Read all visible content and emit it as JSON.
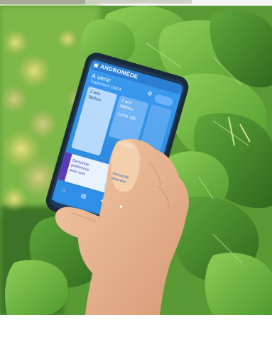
{
  "app": {
    "brand": "ANDROMÈDE",
    "section_title": "A venir",
    "subtitle": "Traitement 16/04",
    "card_1_line_1": "2 ans",
    "card_1_line_2": "Biobox",
    "card_2_line_1": "2 ans",
    "card_2_line_2": "Mildiou",
    "card_2_line_3": "12/04 18h",
    "tab_left_line_1": "Demande",
    "tab_left_line_2": "préférence",
    "tab_left_line_3": "pour une",
    "tab_right_line_1": "Demande",
    "tab_right_line_2": "réservée"
  },
  "colors": {
    "screen_blue": "#2f8fe6",
    "screen_light": "#cfe6ff",
    "accent_purple": "#5b3bb8",
    "phone_body": "#1b2a3a",
    "leaf_green": "#6fb63c",
    "leaf_dark": "#3f7f27",
    "bokeh_yellow": "#e9d76a"
  },
  "icons": {
    "logo": "app-logo-icon",
    "home": "home-icon",
    "calendar": "calendar-icon",
    "add": "add-icon",
    "profile": "profile-icon"
  }
}
